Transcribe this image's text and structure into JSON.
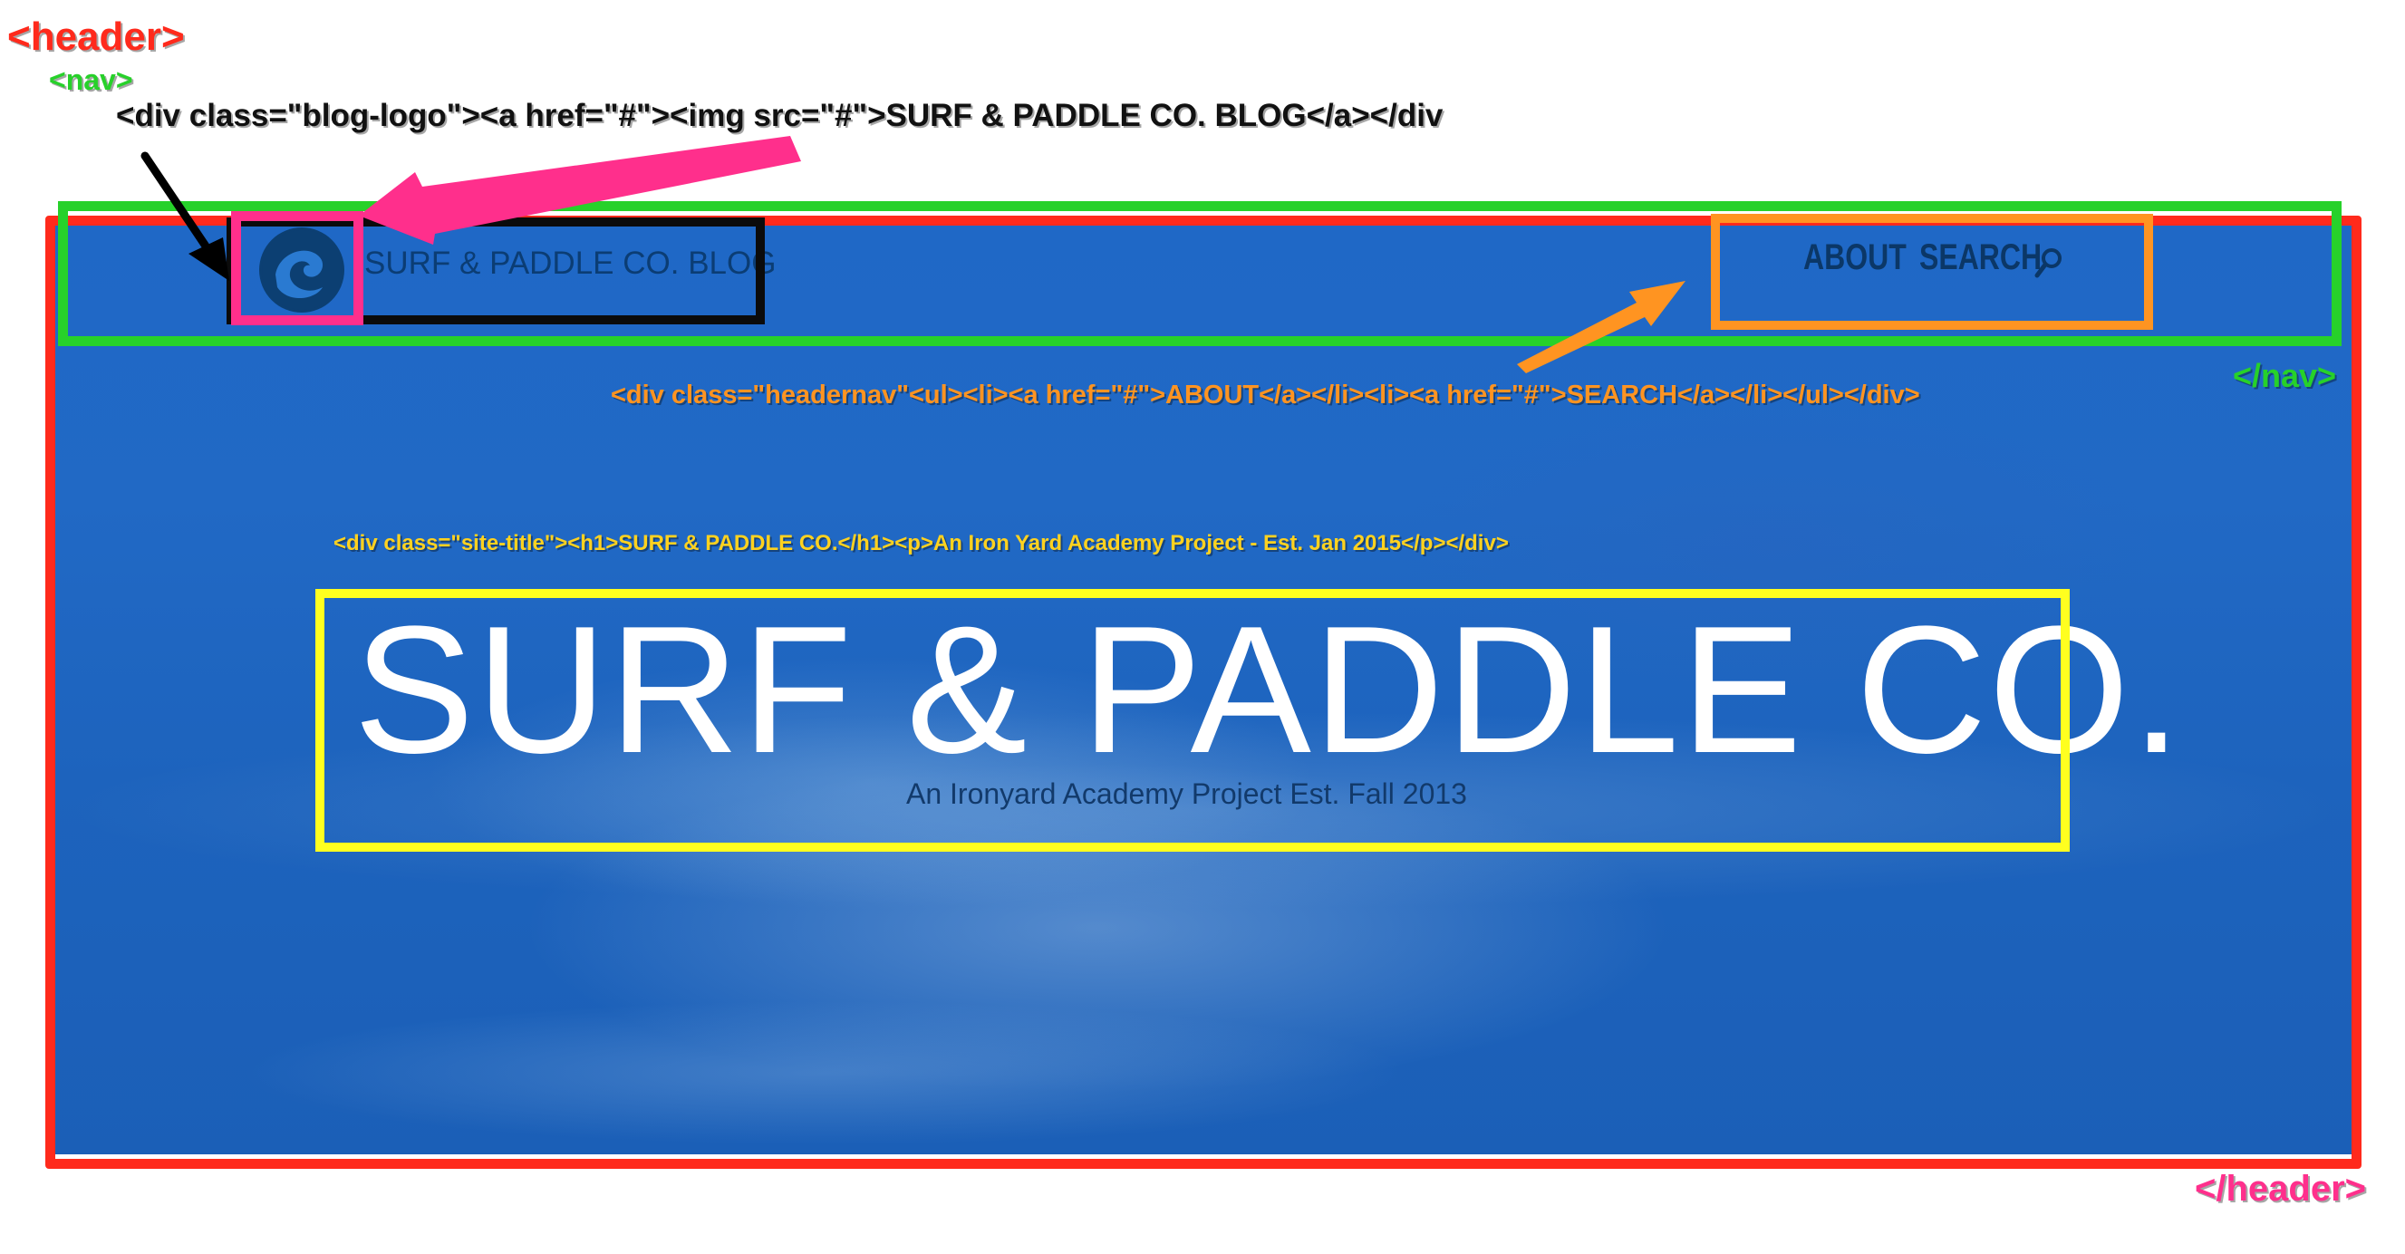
{
  "annotations": {
    "header_open": "<header>",
    "nav_open": "<nav>",
    "blog_logo_code": "<div class=\"blog-logo\"><a href=\"#\"><img src=\"#\">SURF & PADDLE CO. BLOG</a></div",
    "headernav_code": "<div class=\"headernav\"<ul><li><a href=\"#\">ABOUT</a></li><li><a href=\"#\">SEARCH</a></li></ul></div>",
    "nav_close": "</nav>",
    "site_title_code": "<div class=\"site-title\"><h1>SURF & PADDLE CO.</h1><p>An Iron Yard Academy Project - Est. Jan 2015</p></div>",
    "header_close": "</header>"
  },
  "site": {
    "blog_logo_text": "SURF & PADDLE CO. BLOG",
    "nav": {
      "about": "ABOUT",
      "search": "SEARCH"
    },
    "title": "SURF & PADDLE CO.",
    "subtitle": "An Ironyard Academy Project Est. Fall 2013"
  },
  "colors": {
    "header": "#ff2a1c",
    "nav": "#27d12a",
    "blog_logo": "#0b0b0b",
    "img": "#ff2f8c",
    "headernav": "#ff9421",
    "site_title": "#ffff1f",
    "hero": "#1f68c6"
  },
  "icons": [
    "logo-icon",
    "search-icon",
    "arrow-icon"
  ]
}
